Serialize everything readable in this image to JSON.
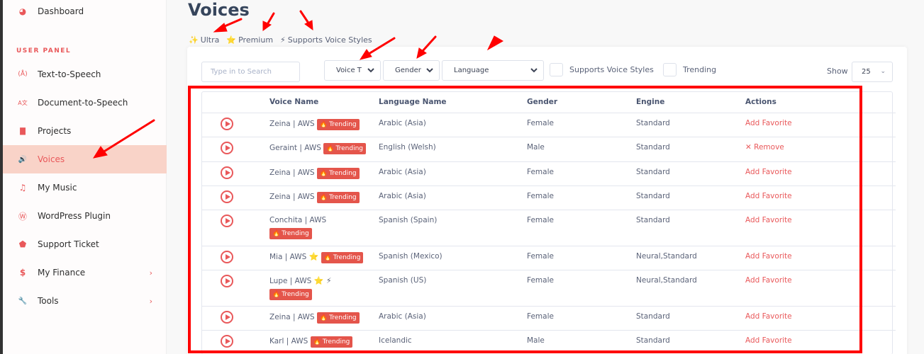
{
  "sidebar": {
    "section_label": "USER PANEL",
    "items": [
      {
        "label": "Dashboard",
        "icon": "dashboard-icon",
        "glyph": "◕"
      },
      {
        "label": "Text-to-Speech",
        "icon": "broadcast-a-icon",
        "glyph": "(Å)"
      },
      {
        "label": "Document-to-Speech",
        "icon": "translate-icon",
        "glyph": "A文"
      },
      {
        "label": "Projects",
        "icon": "folder-icon",
        "glyph": "▇"
      },
      {
        "label": "Voices",
        "icon": "speaker-icon",
        "glyph": "🔊"
      },
      {
        "label": "My Music",
        "icon": "music-note-icon",
        "glyph": "♫"
      },
      {
        "label": "WordPress Plugin",
        "icon": "wordpress-icon",
        "glyph": "Ⓦ"
      },
      {
        "label": "Support Ticket",
        "icon": "tag-icon",
        "glyph": "⬟"
      },
      {
        "label": "My Finance",
        "icon": "dollar-icon",
        "glyph": "$"
      },
      {
        "label": "Tools",
        "icon": "wrench-icon",
        "glyph": "🔧"
      }
    ],
    "chevron": "›"
  },
  "page": {
    "title": "Voices",
    "legend": [
      {
        "glyph": "✨",
        "label": "Ultra"
      },
      {
        "glyph": "⭐",
        "label": "Premium"
      },
      {
        "glyph": "⚡",
        "label": "Supports Voice Styles"
      }
    ]
  },
  "filters": {
    "search_placeholder": "Type in to Search",
    "voice_type": "Voice T",
    "gender": "Gender",
    "language": "Language",
    "supports_voice_styles_label": "Supports Voice Styles",
    "trending_label": "Trending",
    "show_label": "Show",
    "show_value": "25"
  },
  "table": {
    "headers": [
      "",
      "Voice Name",
      "Language Name",
      "Gender",
      "Engine",
      "Actions"
    ],
    "trending_label": "Trending",
    "rows": [
      {
        "voice": "Zeina | AWS",
        "icons": "",
        "wrap": false,
        "language": "Arabic (Asia)",
        "gender": "Female",
        "engine": "Standard",
        "action": "Add Favorite"
      },
      {
        "voice": "Geraint | AWS",
        "icons": "",
        "wrap": false,
        "language": "English (Welsh)",
        "gender": "Male",
        "engine": "Standard",
        "action": "✕ Remove"
      },
      {
        "voice": "Zeina | AWS",
        "icons": "",
        "wrap": false,
        "language": "Arabic (Asia)",
        "gender": "Female",
        "engine": "Standard",
        "action": "Add Favorite"
      },
      {
        "voice": "Zeina | AWS",
        "icons": "",
        "wrap": false,
        "language": "Arabic (Asia)",
        "gender": "Female",
        "engine": "Standard",
        "action": "Add Favorite"
      },
      {
        "voice": "Conchita | AWS",
        "icons": "",
        "wrap": true,
        "language": "Spanish (Spain)",
        "gender": "Female",
        "engine": "Standard",
        "action": "Add Favorite"
      },
      {
        "voice": "Mia | AWS",
        "icons": "⭐",
        "wrap": false,
        "language": "Spanish (Mexico)",
        "gender": "Female",
        "engine": "Neural,Standard",
        "action": "Add Favorite"
      },
      {
        "voice": "Lupe | AWS",
        "icons": "⭐ ⚡",
        "wrap": true,
        "language": "Spanish (US)",
        "gender": "Female",
        "engine": "Neural,Standard",
        "action": "Add Favorite"
      },
      {
        "voice": "Zeina | AWS",
        "icons": "",
        "wrap": false,
        "language": "Arabic (Asia)",
        "gender": "Female",
        "engine": "Standard",
        "action": "Add Favorite"
      },
      {
        "voice": "Karl | AWS",
        "icons": "",
        "wrap": false,
        "language": "Icelandic",
        "gender": "Male",
        "engine": "Standard",
        "action": "Add Favorite"
      }
    ]
  },
  "colors": {
    "accent": "#e9585a",
    "active_bg": "#f9d3c8",
    "trending_badge": "#e4554b",
    "annotation": "#ff0000"
  }
}
